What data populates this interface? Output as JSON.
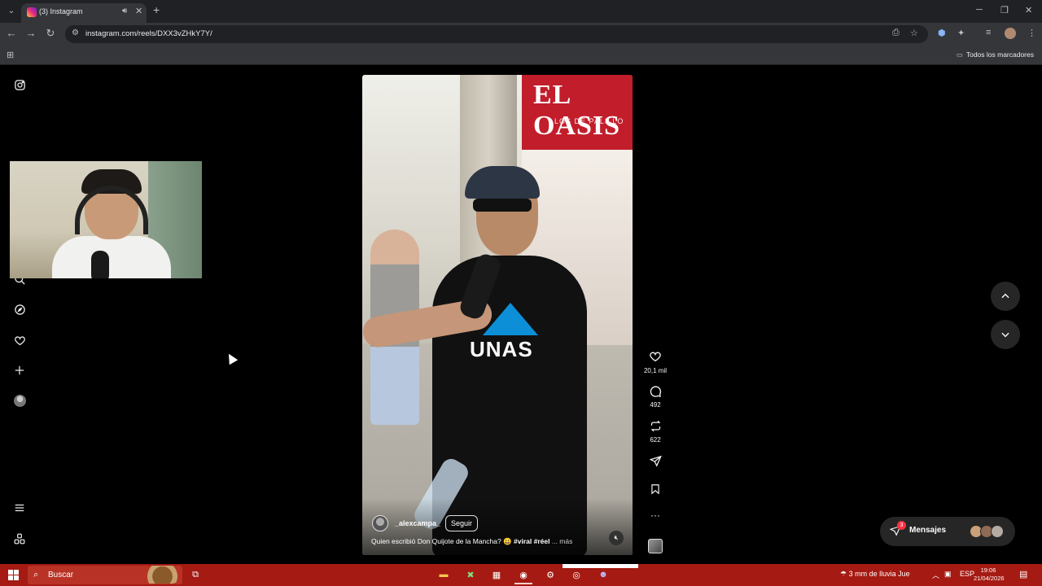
{
  "browser": {
    "tab_title": "(3) Instagram",
    "url": "instagram.com/reels/DXX3vZHkY7Y/",
    "bookmarks_folder": "Todos los marcadores"
  },
  "instagram": {
    "reel": {
      "sign_title": "EL OASIS",
      "sign_subtitle": "LOS DE PALILLO",
      "shirt_text": "UNAS",
      "username": "_alexcampa_",
      "follow_label": "Seguir",
      "caption": "Quien escribió Don Quijote de la Mancha? 😀",
      "caption_tags": "#viral #réel",
      "caption_more": "... más"
    },
    "actions": {
      "likes": "20,1 mil",
      "comments": "492",
      "reposts": "622"
    },
    "messages": {
      "label": "Mensajes",
      "badge": "3"
    }
  },
  "taskbar": {
    "search_label": "Buscar",
    "weather": "3 mm de lluvia Jue",
    "language": "ESP",
    "time": "19:06",
    "date": "21/04/2026"
  }
}
